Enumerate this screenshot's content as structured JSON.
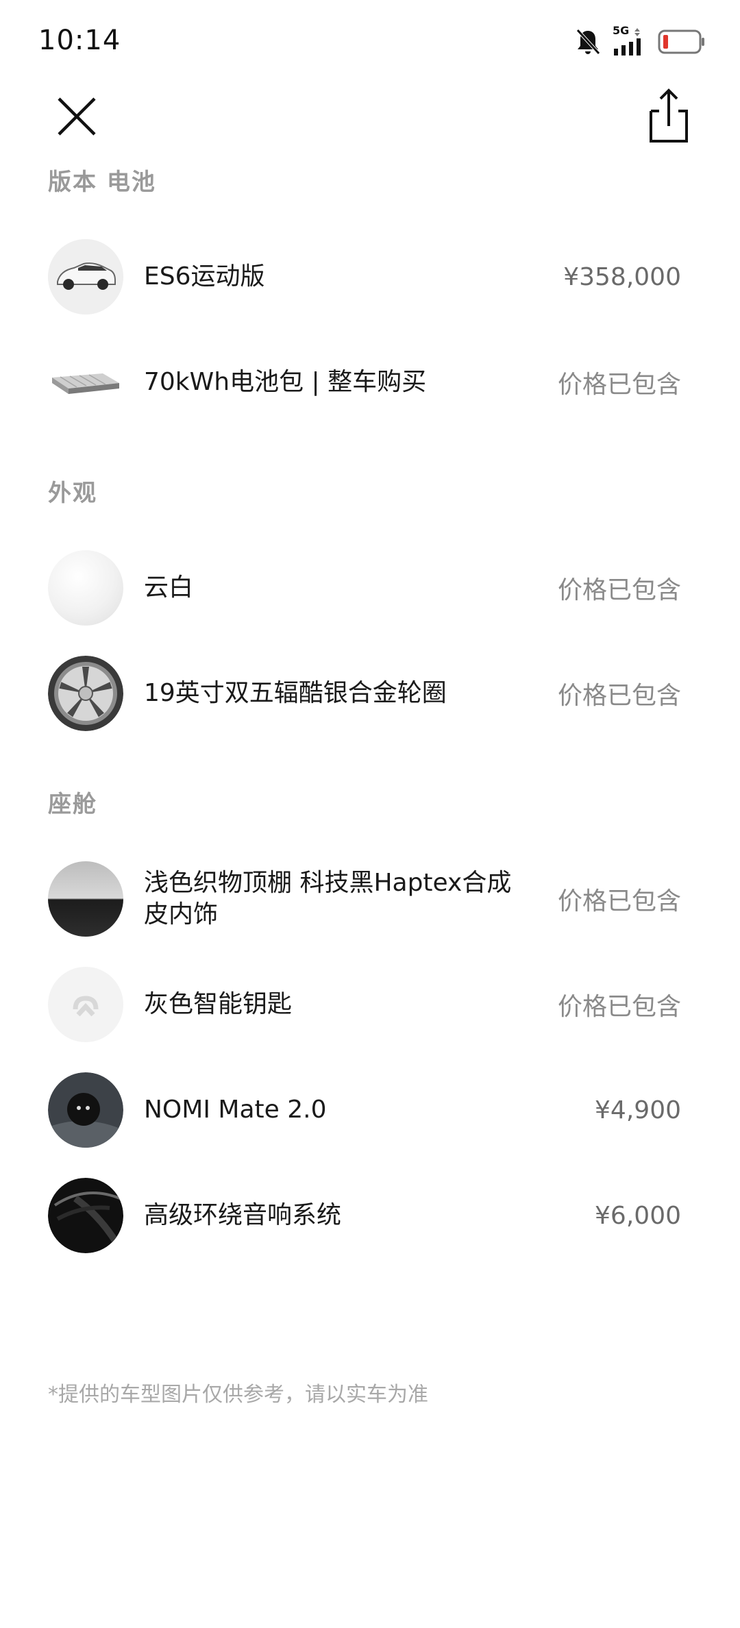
{
  "status_bar": {
    "time": "10:14",
    "network": "5G"
  },
  "sections": {
    "version_battery": "版本 电池",
    "exterior": "外观",
    "cabin": "座舱"
  },
  "items": [
    {
      "name": "ES6运动版",
      "price": "¥358,000"
    },
    {
      "name": "70kWh电池包 | 整车购买",
      "price": "价格已包含"
    },
    {
      "name": "云白",
      "price": "价格已包含"
    },
    {
      "name": "19英寸双五辐酷银合金轮圈",
      "price": "价格已包含"
    },
    {
      "name": "浅色织物顶棚 科技黑Haptex合成皮内饰",
      "price": "价格已包含"
    },
    {
      "name": "灰色智能钥匙",
      "price": "价格已包含"
    },
    {
      "name": "NOMI Mate 2.0",
      "price": "¥4,900"
    },
    {
      "name": "高级环绕音响系统",
      "price": "¥6,000"
    }
  ],
  "disclaimer": "*提供的车型图片仅供参考，请以实车为准",
  "icons": {
    "close": "close-icon",
    "share": "share-icon",
    "mute": "bell-off-icon",
    "signal": "signal-icon",
    "battery": "battery-icon"
  },
  "colors": {
    "section_title": "#9a9a9a",
    "price": "#8a8a8a",
    "battery_low": "#e0362c"
  }
}
